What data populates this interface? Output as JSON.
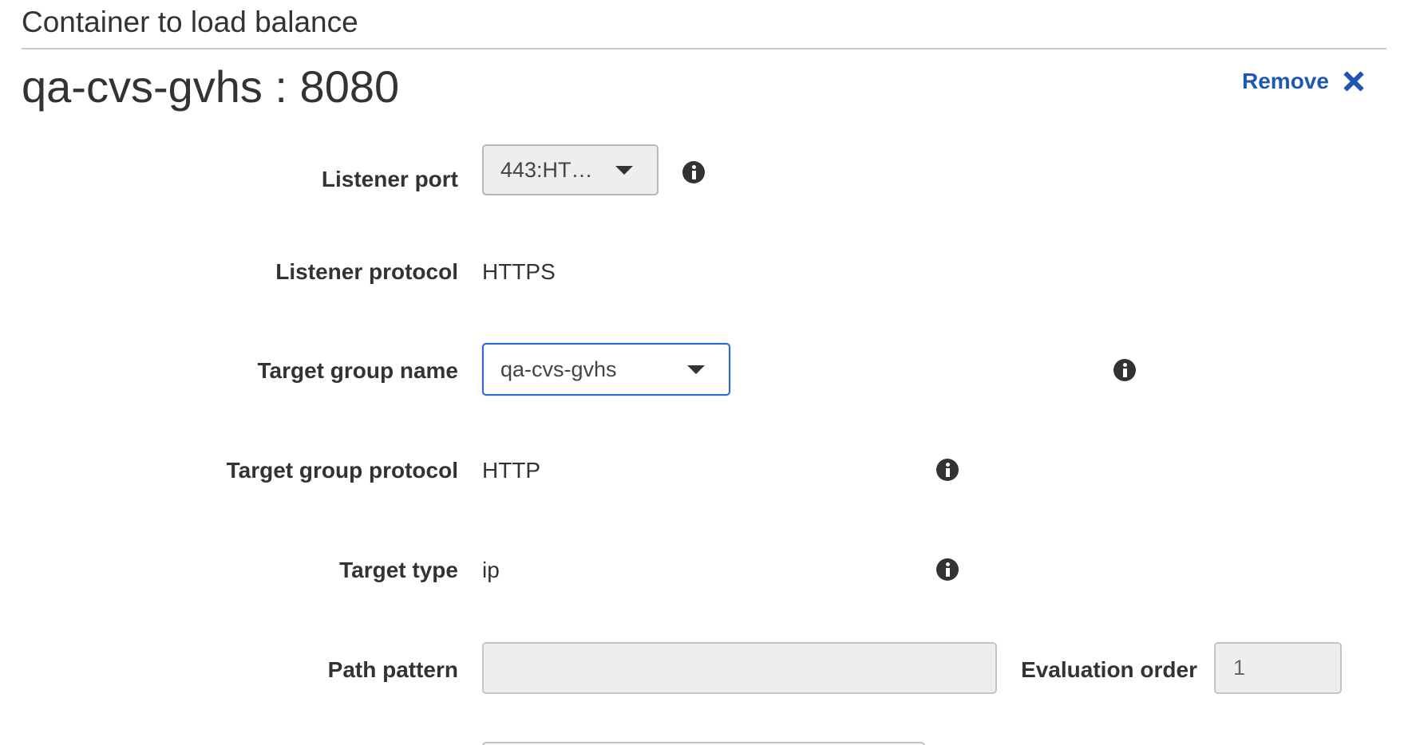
{
  "section": {
    "title": "Container to load balance"
  },
  "container": {
    "heading": "qa-cvs-gvhs : 8080",
    "remove_label": "Remove"
  },
  "form": {
    "listener_port": {
      "label": "Listener port",
      "selected": "443:HT…",
      "info_icon": "info-icon"
    },
    "listener_protocol": {
      "label": "Listener protocol",
      "value": "HTTPS"
    },
    "target_group_name": {
      "label": "Target group name",
      "selected": "qa-cvs-gvhs",
      "info_icon": "info-icon"
    },
    "target_group_protocol": {
      "label": "Target group protocol",
      "value": "HTTP",
      "info_icon": "info-icon"
    },
    "target_type": {
      "label": "Target type",
      "value": "ip",
      "info_icon": "info-icon"
    },
    "path_pattern": {
      "label": "Path pattern",
      "value": ""
    },
    "evaluation_order": {
      "label": "Evaluation order",
      "value": "1"
    }
  },
  "colors": {
    "link": "#1f57b4",
    "focus_border": "#2d6ad6",
    "text": "#333333",
    "disabled_bg": "#eeeeee"
  }
}
